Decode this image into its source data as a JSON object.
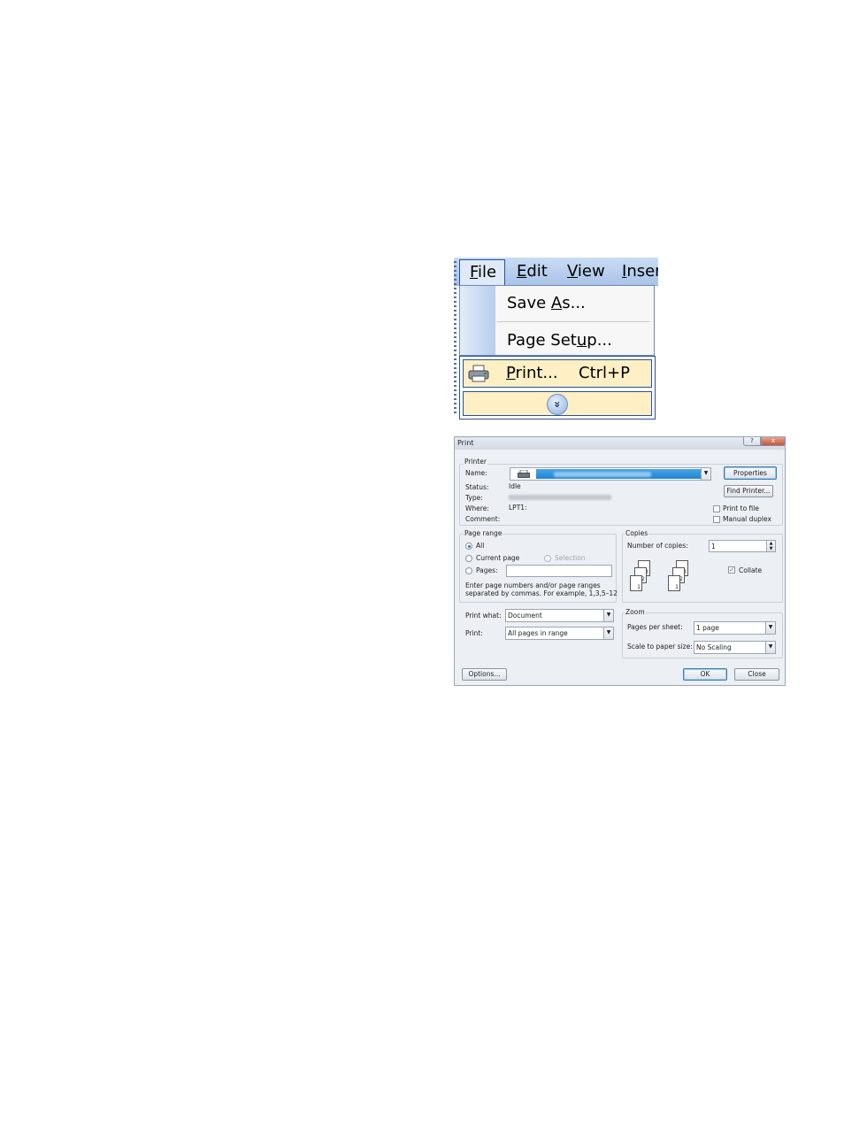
{
  "menu": {
    "menubar": {
      "file": {
        "pre": "",
        "accel": "F",
        "post": "ile"
      },
      "edit": {
        "pre": "",
        "accel": "E",
        "post": "dit"
      },
      "view": {
        "pre": "",
        "accel": "V",
        "post": "iew"
      },
      "insert": {
        "pre": "",
        "accel": "I",
        "post": "nser"
      }
    },
    "items": {
      "save_as": {
        "pre": "Save ",
        "accel": "A",
        "post": "s..."
      },
      "page_setup": {
        "pre": "Page Set",
        "accel": "u",
        "post": "p..."
      },
      "print": {
        "pre": "",
        "accel": "P",
        "post": "rint...",
        "shortcut": "Ctrl+P"
      }
    },
    "expand_glyph": "»"
  },
  "dialog": {
    "title": "Print",
    "help_glyph": "?",
    "close_glyph": "x",
    "printer": {
      "group_label": "Printer",
      "name_label": "Name:",
      "status_label": "Status:",
      "status_value": "Idle",
      "type_label": "Type:",
      "where_label": "Where:",
      "where_value": "LPT1:",
      "comment_label": "Comment:",
      "properties_button": "Properties",
      "find_printer_button": "Find Printer...",
      "print_to_file": "Print to file",
      "manual_duplex": "Manual duplex"
    },
    "page_range": {
      "group_label": "Page range",
      "all": "All",
      "current_page": "Current page",
      "selection": "Selection",
      "pages": "Pages:",
      "hint_line1": "Enter page numbers and/or page ranges",
      "hint_line2": "separated by commas.  For example, 1,3,5–12"
    },
    "copies": {
      "group_label": "Copies",
      "number_label": "Number of copies:",
      "number_value": "1",
      "collate": "Collate"
    },
    "print_what_label": "Print what:",
    "print_what_value": "Document",
    "print_label": "Print:",
    "print_value": "All pages in range",
    "zoom": {
      "group_label": "Zoom",
      "pages_per_sheet_label": "Pages per sheet:",
      "pages_per_sheet_value": "1 page",
      "scale_label": "Scale to paper size:",
      "scale_value": "No Scaling"
    },
    "options_button": "Options...",
    "ok_button": "OK",
    "close_button": "Close",
    "collate_page_numbers": [
      "3",
      "2",
      "1"
    ]
  }
}
